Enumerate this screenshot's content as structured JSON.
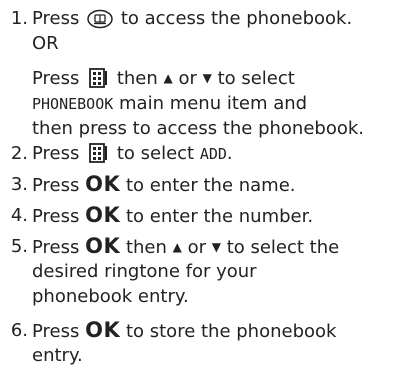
{
  "steps": [
    {
      "number": "1.",
      "line1": {
        "a": "Press ",
        "b": " to access the phonebook."
      },
      "or_label": "OR",
      "line3": {
        "a": "Press ",
        "b": " then ",
        "up": "▲",
        "c": " or ",
        "down": "▼",
        "d": " to select"
      },
      "line4": {
        "menu": "PHONEBOOK",
        "a": " main menu item and"
      },
      "line5": "then press to access the phonebook."
    },
    {
      "number": "2.",
      "line1": {
        "a": "Press ",
        "b": " to select ",
        "menu": "ADD",
        "c": "."
      }
    },
    {
      "number": "3.",
      "line1": {
        "a": "Press ",
        "ok": "OK",
        "b": " to enter the name."
      }
    },
    {
      "number": "4.",
      "line1": {
        "a": "Press ",
        "ok": "OK",
        "b": " to enter the number."
      }
    },
    {
      "number": "5.",
      "line1": {
        "a": "Press ",
        "ok": "OK",
        "b": " then ",
        "up": "▲",
        "c": " or ",
        "down": "▼",
        "d": " to select the"
      },
      "line2": "desired ringtone for your",
      "line3": "phonebook entry."
    },
    {
      "number": "6.",
      "line1": {
        "a": "Press ",
        "ok": "OK",
        "b": " to store the phonebook"
      },
      "line2": "entry."
    }
  ]
}
